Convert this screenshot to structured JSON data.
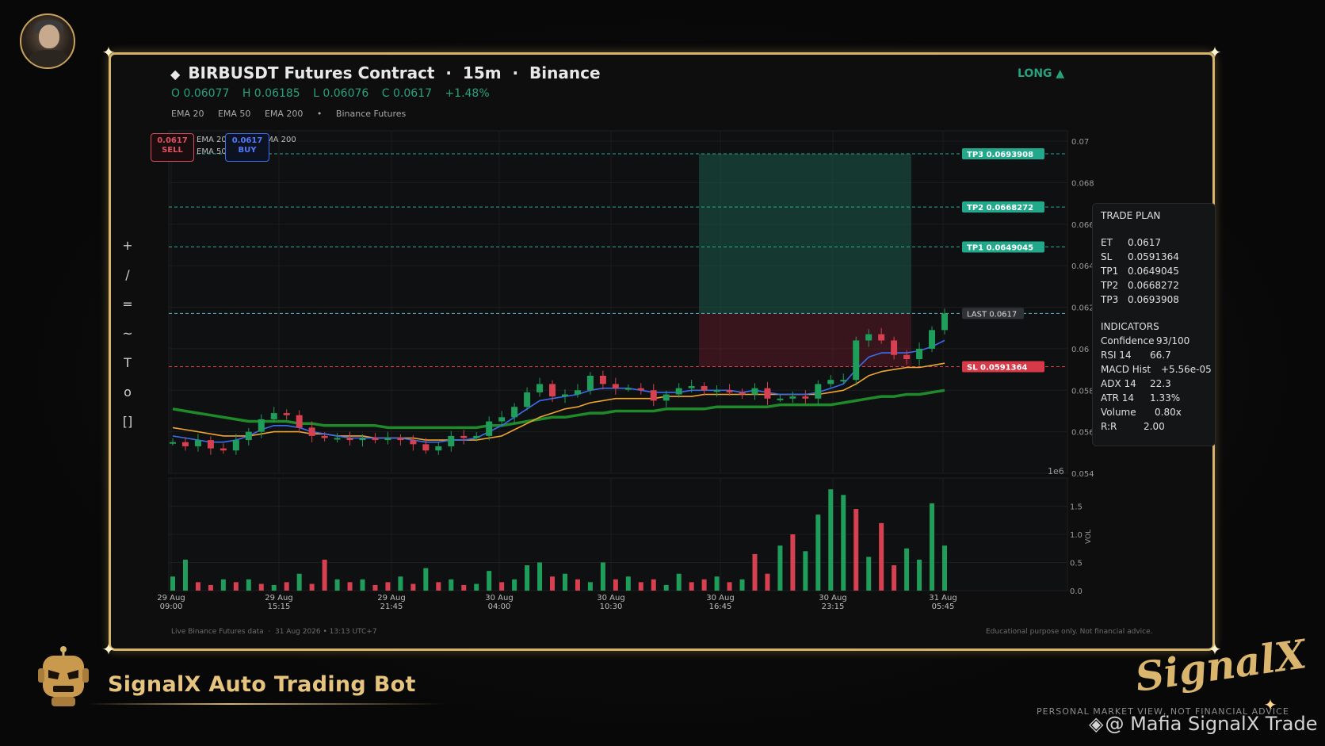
{
  "header": {
    "title": "BIRBUSDT Futures Contract  ·  15m  ·  Binance",
    "title_icon": "diamond-icon",
    "ohlc": {
      "open": "O 0.06077",
      "high": "H 0.06185",
      "low": "L 0.06076",
      "close": "C 0.0617",
      "change": "+1.48%"
    },
    "legend": [
      "EMA 20",
      "EMA 50",
      "EMA 200",
      "•",
      "Binance Futures"
    ],
    "direction": "LONG ▲"
  },
  "toolbar": {
    "tools": [
      "+",
      "/",
      "=",
      "~",
      "T",
      "o",
      "[]"
    ]
  },
  "order_badges": {
    "sell_price": "0.0617",
    "sell_label": "SELL",
    "buy_price": "0.0617",
    "buy_label": "BUY",
    "ema_mini": [
      "EMA 20",
      "EMA 50",
      "MA 200"
    ]
  },
  "levels": {
    "tp3": "TP3  0.0693908",
    "tp2": "TP2  0.0668272",
    "tp1": "TP1  0.0649045",
    "last": "LAST  0.0617",
    "sl": "SL  0.0591364"
  },
  "trade_plan": {
    "title": "TRADE PLAN",
    "rows": [
      {
        "k": "ET",
        "v": "0.0617"
      },
      {
        "k": "SL",
        "v": "0.0591364"
      },
      {
        "k": "TP1",
        "v": "0.0649045"
      },
      {
        "k": "TP2",
        "v": "0.0668272"
      },
      {
        "k": "TP3",
        "v": "0.0693908"
      }
    ],
    "indicators_title": "INDICATORS",
    "indicators": [
      {
        "k": "Confidence",
        "v": "93/100"
      },
      {
        "k": "RSI 14",
        "v": "66.7"
      },
      {
        "k": "MACD Hist",
        "v": "+5.56e-05"
      },
      {
        "k": "ADX 14",
        "v": "22.3"
      },
      {
        "k": "ATR 14",
        "v": "1.33%"
      },
      {
        "k": "Volume",
        "v": "0.80x"
      },
      {
        "k": "R:R",
        "v": "2.00"
      }
    ]
  },
  "chart_data": {
    "type": "candlestick",
    "price_axis": {
      "ticks": [
        "0.07",
        "0.068",
        "0.066",
        "0.064",
        "0.062",
        "0.06",
        "0.058",
        "0.056",
        "0.054"
      ],
      "range": [
        0.054,
        0.0705
      ],
      "exponent_label": "1e6"
    },
    "volume_axis": {
      "ticks": [
        "1.5",
        "1.0",
        "0.5",
        "0.0"
      ],
      "label": "VOL",
      "range": [
        0,
        2.0
      ]
    },
    "x_ticks": [
      {
        "top": "29 Aug",
        "bottom": "09:00"
      },
      {
        "top": "29 Aug",
        "bottom": "15:15"
      },
      {
        "top": "29 Aug",
        "bottom": "21:45"
      },
      {
        "top": "30 Aug",
        "bottom": "04:00"
      },
      {
        "top": "30 Aug",
        "bottom": "10:30"
      },
      {
        "top": "30 Aug",
        "bottom": "16:45"
      },
      {
        "top": "30 Aug",
        "bottom": "23:15"
      },
      {
        "top": "31 Aug",
        "bottom": "05:45"
      }
    ],
    "levels": {
      "tp3": 0.0693908,
      "tp2": 0.0668272,
      "tp1": 0.0649045,
      "entry": 0.0617,
      "sl": 0.0591364
    },
    "close_path": [
      0.0555,
      0.0553,
      0.0556,
      0.0552,
      0.0551,
      0.0556,
      0.056,
      0.0566,
      0.0569,
      0.0568,
      0.0562,
      0.0558,
      0.0557,
      0.0557,
      0.0556,
      0.0557,
      0.0556,
      0.0557,
      0.0556,
      0.0554,
      0.0551,
      0.0553,
      0.0558,
      0.0557,
      0.0558,
      0.0565,
      0.0567,
      0.0572,
      0.0579,
      0.0583,
      0.0577,
      0.0578,
      0.058,
      0.0587,
      0.0583,
      0.0581,
      0.0581,
      0.058,
      0.0575,
      0.0578,
      0.0581,
      0.0582,
      0.058,
      0.058,
      0.0579,
      0.0578,
      0.0581,
      0.0576,
      0.0576,
      0.0577,
      0.0576,
      0.0583,
      0.0585,
      0.0585,
      0.0604,
      0.0607,
      0.0604,
      0.0597,
      0.0595,
      0.06,
      0.0609,
      0.0617
    ],
    "ema20": [
      0.0558,
      0.0557,
      0.0556,
      0.0555,
      0.0555,
      0.0556,
      0.0558,
      0.0561,
      0.0563,
      0.0563,
      0.0562,
      0.056,
      0.0559,
      0.0558,
      0.0557,
      0.0557,
      0.0557,
      0.0557,
      0.0557,
      0.0556,
      0.0555,
      0.0555,
      0.0556,
      0.0556,
      0.0557,
      0.056,
      0.0563,
      0.0567,
      0.0571,
      0.0575,
      0.0576,
      0.0577,
      0.0578,
      0.058,
      0.0581,
      0.0581,
      0.0581,
      0.058,
      0.0579,
      0.0579,
      0.0579,
      0.058,
      0.058,
      0.058,
      0.058,
      0.0579,
      0.058,
      0.0579,
      0.0578,
      0.0578,
      0.0578,
      0.0579,
      0.0581,
      0.0583,
      0.059,
      0.0596,
      0.0598,
      0.0598,
      0.0598,
      0.0599,
      0.0601,
      0.0604
    ],
    "ema50": [
      0.0562,
      0.0561,
      0.056,
      0.0559,
      0.0558,
      0.0558,
      0.0558,
      0.0559,
      0.056,
      0.056,
      0.056,
      0.0559,
      0.0559,
      0.0558,
      0.0558,
      0.0558,
      0.0557,
      0.0557,
      0.0557,
      0.0557,
      0.0556,
      0.0556,
      0.0556,
      0.0556,
      0.0556,
      0.0557,
      0.0558,
      0.0561,
      0.0564,
      0.0567,
      0.0569,
      0.0571,
      0.0572,
      0.0574,
      0.0575,
      0.0576,
      0.0576,
      0.0576,
      0.0576,
      0.0577,
      0.0577,
      0.0577,
      0.0578,
      0.0578,
      0.0578,
      0.0578,
      0.0578,
      0.0578,
      0.0578,
      0.0578,
      0.0578,
      0.0578,
      0.0579,
      0.058,
      0.0583,
      0.0587,
      0.0589,
      0.059,
      0.0591,
      0.0591,
      0.0592,
      0.0593
    ],
    "ema200": [
      0.0571,
      0.057,
      0.0569,
      0.0568,
      0.0567,
      0.0566,
      0.0565,
      0.0565,
      0.0565,
      0.0565,
      0.0564,
      0.0564,
      0.0563,
      0.0563,
      0.0563,
      0.0563,
      0.0563,
      0.0562,
      0.0562,
      0.0562,
      0.0562,
      0.0562,
      0.0562,
      0.0562,
      0.0562,
      0.0563,
      0.0563,
      0.0564,
      0.0565,
      0.0566,
      0.0567,
      0.0567,
      0.0568,
      0.0569,
      0.0569,
      0.057,
      0.057,
      0.057,
      0.057,
      0.0571,
      0.0571,
      0.0571,
      0.0571,
      0.0572,
      0.0572,
      0.0572,
      0.0572,
      0.0572,
      0.0573,
      0.0573,
      0.0573,
      0.0573,
      0.0573,
      0.0574,
      0.0575,
      0.0576,
      0.0577,
      0.0577,
      0.0578,
      0.0578,
      0.0579,
      0.058
    ],
    "volume": [
      0.25,
      0.55,
      0.15,
      0.1,
      0.2,
      0.15,
      0.2,
      0.12,
      0.1,
      0.15,
      0.3,
      0.12,
      0.55,
      0.2,
      0.15,
      0.2,
      0.1,
      0.15,
      0.25,
      0.12,
      0.4,
      0.15,
      0.2,
      0.1,
      0.12,
      0.35,
      0.15,
      0.2,
      0.45,
      0.5,
      0.25,
      0.3,
      0.2,
      0.15,
      0.5,
      0.2,
      0.25,
      0.15,
      0.2,
      0.1,
      0.3,
      0.15,
      0.2,
      0.25,
      0.15,
      0.2,
      0.65,
      0.3,
      0.8,
      1.0,
      0.7,
      1.35,
      1.8,
      1.7,
      1.45,
      0.6,
      1.2,
      0.45,
      0.75,
      0.55,
      1.55,
      0.8
    ],
    "volume_up": [
      true,
      true,
      false,
      false,
      true,
      false,
      true,
      false,
      true,
      false,
      true,
      false,
      false,
      true,
      false,
      true,
      false,
      false,
      true,
      false,
      true,
      false,
      true,
      false,
      true,
      true,
      false,
      true,
      true,
      true,
      false,
      true,
      false,
      true,
      true,
      false,
      true,
      false,
      false,
      true,
      true,
      false,
      false,
      true,
      false,
      true,
      false,
      false,
      true,
      false,
      true,
      true,
      true,
      true,
      false,
      true,
      false,
      false,
      true,
      true,
      true,
      true
    ]
  },
  "footer": {
    "left": "Live Binance Futures data  ·  31 Aug 2026 • 13:13 UTC+7",
    "right": "Educational purpose only. Not financial advice."
  },
  "branding": {
    "bot_name": "SignalX Auto Trading Bot",
    "logo_text": "SignalX",
    "disclaimer": "PERSONAL MARKET VIEW, NOT FINANCIAL ADVICE",
    "watermark": "@ Mafia SignalX Trade",
    "accent": "#d7b46a"
  },
  "colors": {
    "up": "#1f9d5b",
    "down": "#d64050",
    "ema20": "#3a6df0",
    "ema50": "#f0a530",
    "ema200": "#1e8a2a",
    "tp": "#27a992",
    "sl": "#e03c4b"
  }
}
